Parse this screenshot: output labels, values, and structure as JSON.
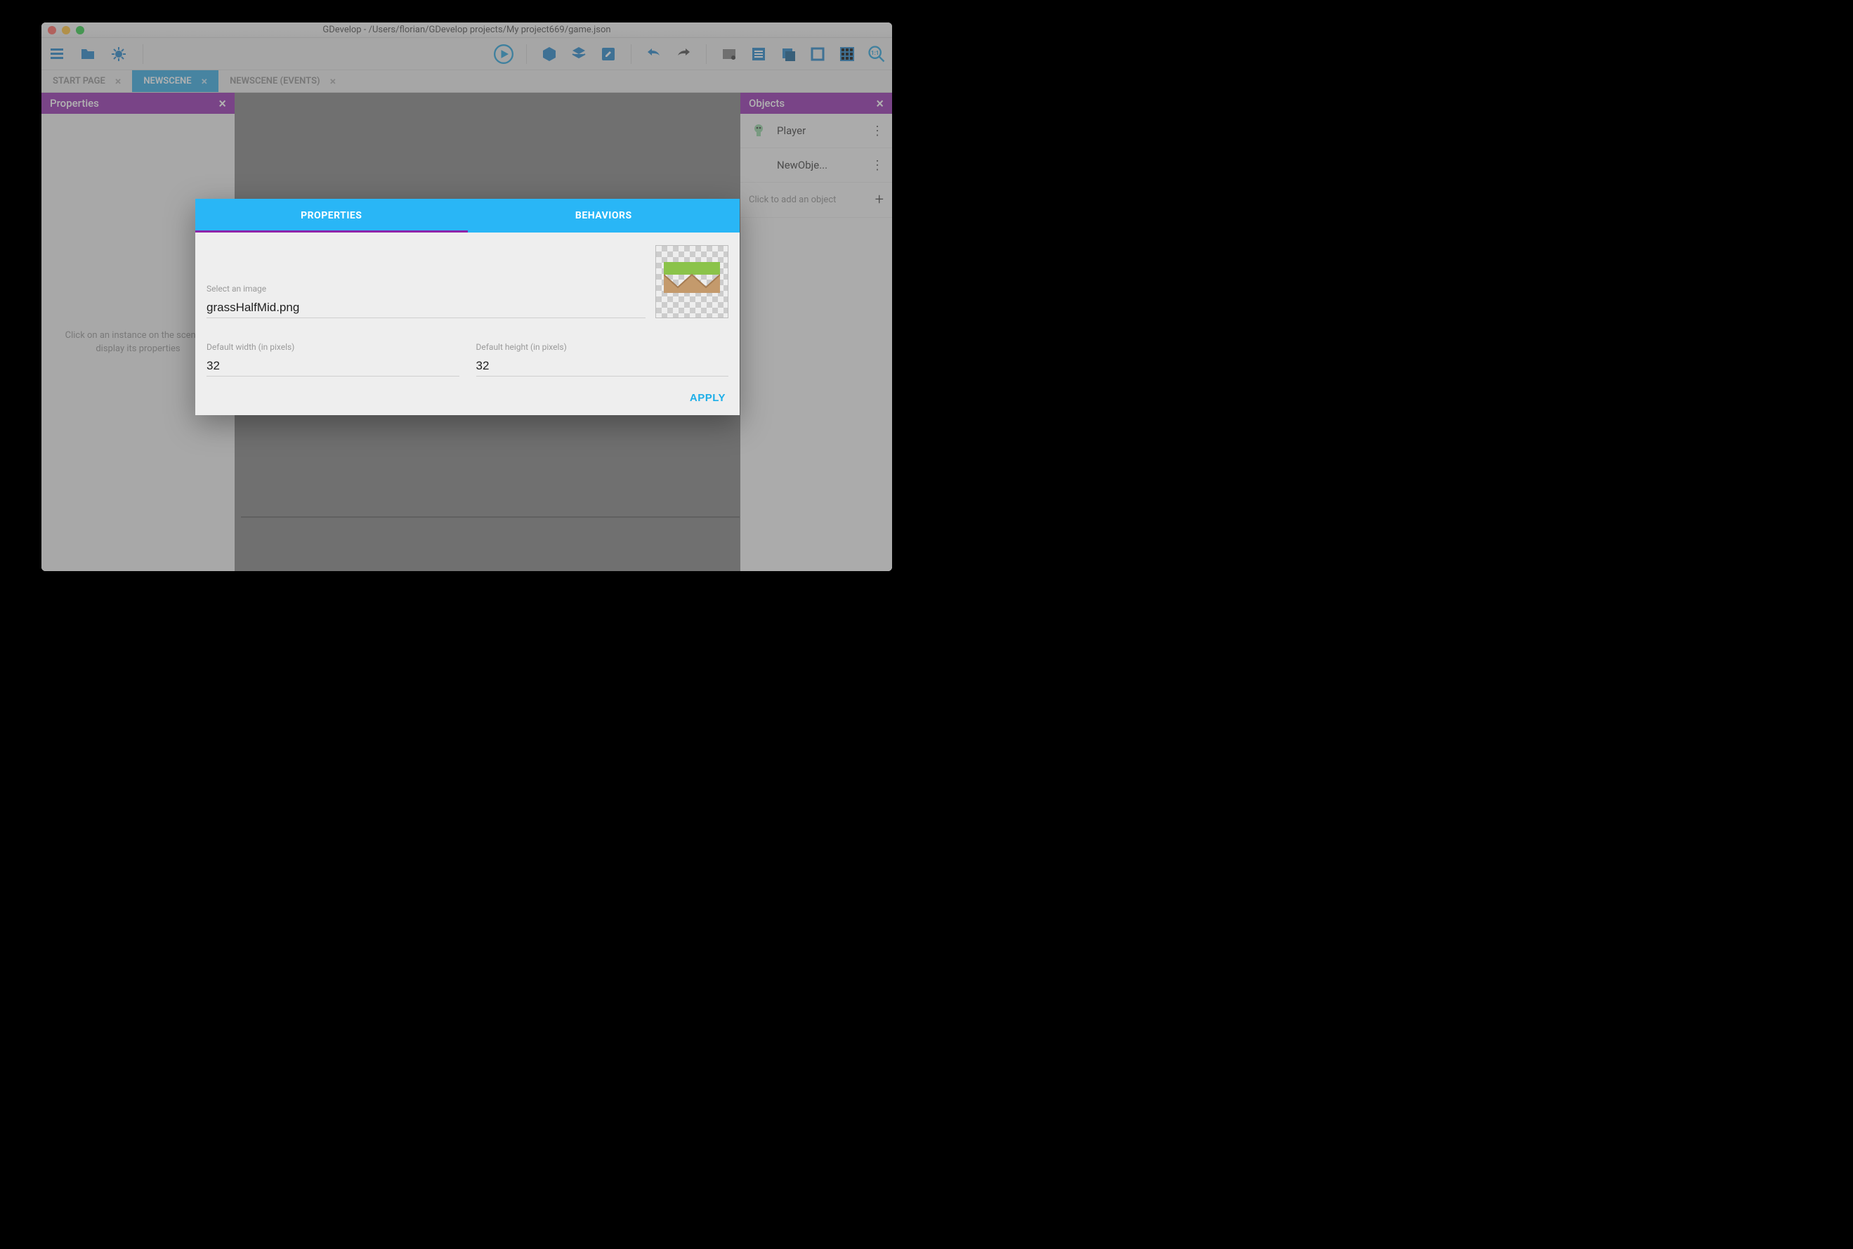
{
  "window": {
    "title": "GDevelop - /Users/florian/GDevelop projects/My project669/game.json"
  },
  "tabs": [
    {
      "label": "START PAGE",
      "active": false
    },
    {
      "label": "NEWSCENE",
      "active": true
    },
    {
      "label": "NEWSCENE (EVENTS)",
      "active": false
    }
  ],
  "panels": {
    "left": {
      "title": "Properties",
      "placeholder": "Click on an instance on the scene to display its properties"
    },
    "right": {
      "title": "Objects",
      "items": [
        {
          "label": "Player"
        },
        {
          "label": "NewObje..."
        }
      ],
      "add_label": "Click to add an object"
    }
  },
  "dialog": {
    "tabs": {
      "properties": "PROPERTIES",
      "behaviors": "BEHAVIORS"
    },
    "image_field": {
      "label": "Select an image",
      "value": "grassHalfMid.png"
    },
    "width_field": {
      "label": "Default width (in pixels)",
      "value": "32"
    },
    "height_field": {
      "label": "Default height (in pixels)",
      "value": "32"
    },
    "apply_label": "APPLY"
  },
  "colors": {
    "accent_blue": "#29b6f6",
    "accent_purple": "#8e24aa"
  }
}
